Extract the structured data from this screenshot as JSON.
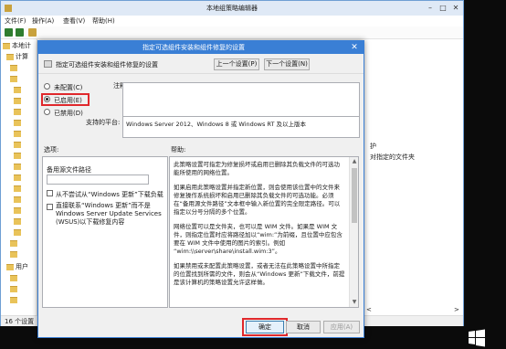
{
  "background_window": {
    "title": "本地组策略编辑器",
    "controls": [
      "–",
      "□",
      "✕"
    ],
    "menu": [
      "文件(F)",
      "操作(A)",
      "查看(V)",
      "帮助(H)"
    ],
    "tree": [
      "本地计",
      "计算",
      "用户"
    ],
    "right_items": [
      "护",
      "对指定的文件夹",
      "<",
      ">"
    ],
    "status": "16 个设置"
  },
  "dialog": {
    "title": "指定可选组件安装和组件修复的设置",
    "close": "✕",
    "setting_name": "指定可选组件安装和组件修复的设置",
    "prev_button": "上一个设置(P)",
    "next_button": "下一个设置(N)",
    "radio_not_configured": "未配置(C)",
    "radio_enabled": "已启用(E)",
    "radio_disabled": "已禁用(D)",
    "selected_radio": "enabled",
    "comment_label": "注释:",
    "supported_label": "支持的平台:",
    "supported_value": "Windows Server 2012、Windows 8 或 Windows RT 及以上版本",
    "options_label": "选项:",
    "help_label": "帮助:",
    "alt_path_label": "备用源文件路径",
    "alt_path_value": "",
    "chk_no_wu_label": "从不尝试从“Windows 更新”下载负载",
    "chk_wsus_label": "直接联系“Windows 更新”而不是 Windows Server Update Services (WSUS)以下载修复内容",
    "help_paragraphs": [
      "此策略设置可指定为修复损坏或启用已删除其负载文件的可选功能所使用的网络位置。",
      "如果启用此策略设置并指定新位置，则会使用该位置中的文件来修复操作系统损坏和启用已删除其负载文件的可选功能。必须在“备用源文件路径”文本框中输入新位置的完全限定路径。可以指定以分号分隔的多个位置。",
      "网络位置可以是文件夹，也可以是 WIM 文件。如果是 WIM 文件，则指定位置时应将路径加以“wim:”为前缀，且位置中应包含要在 WIM 文件中使用的图片的索引。例如 “wim:\\\\server\\share\\install.wim:3”。",
      "如果禁用或未配置此策略设置，或者无法在此策略设置中所指定的位置找到所需的文件，则会从“Windows 更新”下载文件，前提是该计算机的策略设置允许这样做。"
    ],
    "ok_button": "确定",
    "cancel_button": "取消",
    "apply_button": "应用(A)"
  }
}
